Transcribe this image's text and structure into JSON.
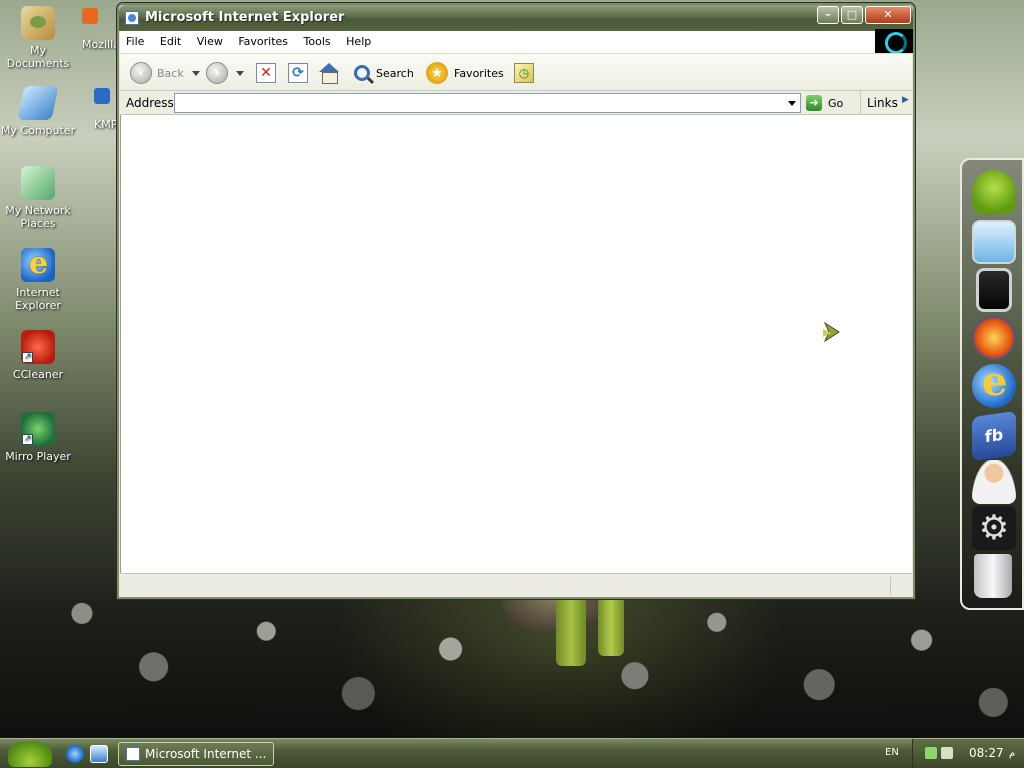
{
  "desktop": {
    "icons": [
      {
        "label": "My Documents",
        "icon": "my-documents-icon"
      },
      {
        "label": "My Computer",
        "icon": "my-computer-icon"
      },
      {
        "label": "My Network Places",
        "icon": "network-places-icon"
      },
      {
        "label": "Internet Explorer",
        "icon": "ie-icon"
      },
      {
        "label": "CCleaner",
        "icon": "ccleaner-icon"
      },
      {
        "label": "Mirro Player",
        "icon": "mirro-player-icon"
      }
    ],
    "partial_icons": [
      {
        "label": "Mozilla",
        "icon": "firefox-icon"
      },
      {
        "label": "KMPl",
        "icon": "kmplayer-icon"
      }
    ]
  },
  "window": {
    "title": "Microsoft Internet Explorer",
    "menu": [
      "File",
      "Edit",
      "View",
      "Favorites",
      "Tools",
      "Help"
    ],
    "toolbar": {
      "back_label": "Back",
      "search_label": "Search",
      "favorites_label": "Favorites"
    },
    "address": {
      "label": "Address",
      "value": "",
      "go_label": "Go",
      "links_label": "Links"
    }
  },
  "dock": {
    "items": [
      "android-icon",
      "monitor-icon",
      "ipad-icon",
      "firefox-icon",
      "ie-icon",
      "facebook-icon",
      "user-support-icon",
      "settings-gear-icon",
      "trash-icon"
    ],
    "fb_text": "fb"
  },
  "taskbar": {
    "task_label": "Microsoft Internet ...",
    "language": "EN",
    "clock": "08:27",
    "clock_suffix": " م"
  },
  "colors": {
    "titlebar": "#5f6e4a",
    "taskbar": "#4d5a37",
    "close_button": "#b33a17"
  }
}
